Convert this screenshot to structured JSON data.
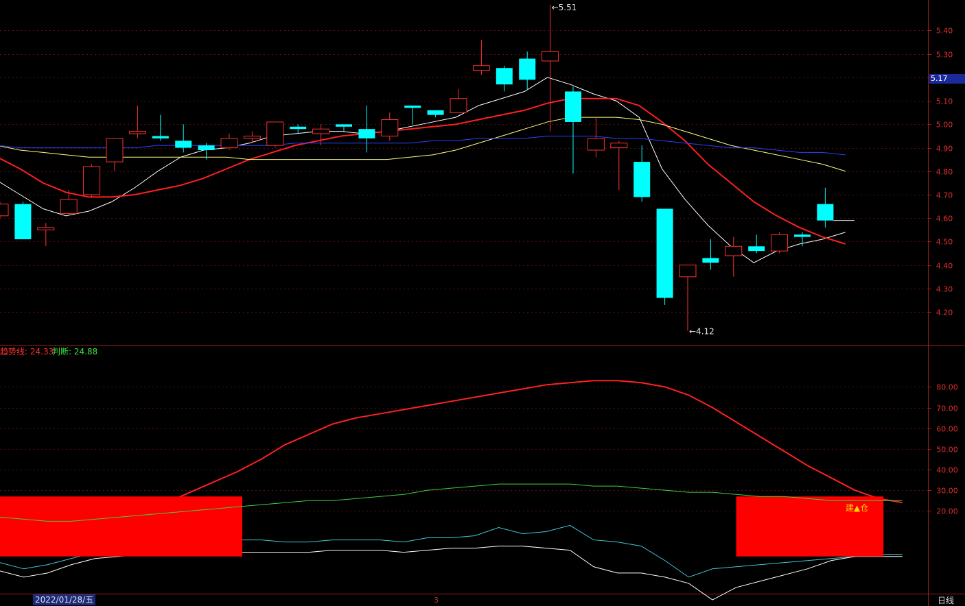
{
  "chart_data": [
    {
      "type": "candlestick",
      "y_ticks": [
        5.4,
        5.3,
        5.2,
        5.1,
        5.0,
        4.9,
        4.8,
        4.7,
        4.6,
        4.5,
        4.4,
        4.3,
        4.2
      ],
      "ylim": [
        4.06,
        5.53
      ],
      "candles": [
        {
          "open": 4.61,
          "close": 4.66,
          "high": 4.67,
          "low": 4.6
        },
        {
          "open": 4.66,
          "close": 4.51,
          "high": 4.67,
          "low": 4.51
        },
        {
          "open": 4.55,
          "close": 4.56,
          "high": 4.58,
          "low": 4.48
        },
        {
          "open": 4.62,
          "close": 4.68,
          "high": 4.72,
          "low": 4.61
        },
        {
          "open": 4.7,
          "close": 4.82,
          "high": 4.83,
          "low": 4.69
        },
        {
          "open": 4.84,
          "close": 4.94,
          "high": 4.94,
          "low": 4.8
        },
        {
          "open": 4.96,
          "close": 4.97,
          "high": 5.08,
          "low": 4.94
        },
        {
          "open": 4.95,
          "close": 4.94,
          "high": 5.04,
          "low": 4.93
        },
        {
          "open": 4.93,
          "close": 4.9,
          "high": 5.0,
          "low": 4.88
        },
        {
          "open": 4.91,
          "close": 4.89,
          "high": 4.92,
          "low": 4.85
        },
        {
          "open": 4.9,
          "close": 4.94,
          "high": 4.96,
          "low": 4.89
        },
        {
          "open": 4.94,
          "close": 4.95,
          "high": 4.97,
          "low": 4.92
        },
        {
          "open": 4.91,
          "close": 5.01,
          "high": 5.01,
          "low": 4.9
        },
        {
          "open": 4.99,
          "close": 4.98,
          "high": 5.0,
          "low": 4.96
        },
        {
          "open": 4.96,
          "close": 4.98,
          "high": 5.0,
          "low": 4.91
        },
        {
          "open": 5.0,
          "close": 4.99,
          "high": 5.0,
          "low": 4.97
        },
        {
          "open": 4.98,
          "close": 4.94,
          "high": 5.08,
          "low": 4.88
        },
        {
          "open": 4.95,
          "close": 5.02,
          "high": 5.05,
          "low": 4.93
        },
        {
          "open": 5.08,
          "close": 5.07,
          "high": 5.08,
          "low": 5.0
        },
        {
          "open": 5.06,
          "close": 5.04,
          "high": 5.06,
          "low": 5.03
        },
        {
          "open": 5.05,
          "close": 5.11,
          "high": 5.15,
          "low": 5.05
        },
        {
          "open": 5.23,
          "close": 5.25,
          "high": 5.36,
          "low": 5.21
        },
        {
          "open": 5.24,
          "close": 5.17,
          "high": 5.25,
          "low": 5.14
        },
        {
          "open": 5.28,
          "close": 5.19,
          "high": 5.31,
          "low": 5.15
        },
        {
          "open": 5.27,
          "close": 5.31,
          "high": 5.51,
          "low": 4.97
        },
        {
          "open": 5.14,
          "close": 5.01,
          "high": 5.16,
          "low": 4.79
        },
        {
          "open": 4.89,
          "close": 4.94,
          "high": 5.03,
          "low": 4.86
        },
        {
          "open": 4.9,
          "close": 4.92,
          "high": 4.93,
          "low": 4.72
        },
        {
          "open": 4.84,
          "close": 4.69,
          "high": 4.91,
          "low": 4.67
        },
        {
          "open": 4.64,
          "close": 4.26,
          "high": 4.64,
          "low": 4.23
        },
        {
          "open": 4.35,
          "close": 4.4,
          "high": 4.4,
          "low": 4.12
        },
        {
          "open": 4.43,
          "close": 4.41,
          "high": 4.51,
          "low": 4.38
        },
        {
          "open": 4.44,
          "close": 4.48,
          "high": 4.52,
          "low": 4.35
        },
        {
          "open": 4.48,
          "close": 4.46,
          "high": 4.53,
          "low": 4.45
        },
        {
          "open": 4.46,
          "close": 4.53,
          "high": 4.54,
          "low": 4.45
        },
        {
          "open": 4.53,
          "close": 4.52,
          "high": 4.54,
          "low": 4.48
        },
        {
          "open": 4.66,
          "close": 4.59,
          "high": 4.73,
          "low": 4.56
        }
      ],
      "ma_lines": [
        {
          "color": "#ffffff",
          "values": [
            4.76,
            4.7,
            4.64,
            4.61,
            4.63,
            4.67,
            4.73,
            4.8,
            4.86,
            4.89,
            4.9,
            4.92,
            4.95,
            4.96,
            4.97,
            4.97,
            4.96,
            4.97,
            4.99,
            5.01,
            5.03,
            5.08,
            5.11,
            5.14,
            5.2,
            5.17,
            5.13,
            5.1,
            5.03,
            4.81,
            4.68,
            4.57,
            4.48,
            4.41,
            4.46,
            4.49,
            4.51,
            4.54
          ]
        },
        {
          "color": "#ff2020",
          "values": [
            4.86,
            4.81,
            4.75,
            4.71,
            4.69,
            4.69,
            4.7,
            4.72,
            4.74,
            4.77,
            4.81,
            4.85,
            4.88,
            4.91,
            4.93,
            4.95,
            4.96,
            4.97,
            4.98,
            4.99,
            5.0,
            5.02,
            5.04,
            5.06,
            5.09,
            5.11,
            5.11,
            5.11,
            5.08,
            5.01,
            4.93,
            4.83,
            4.75,
            4.67,
            4.61,
            4.56,
            4.52,
            4.49
          ]
        },
        {
          "color": "#ffff80",
          "values": [
            4.91,
            4.89,
            4.88,
            4.87,
            4.86,
            4.86,
            4.86,
            4.86,
            4.86,
            4.86,
            4.86,
            4.85,
            4.85,
            4.85,
            4.85,
            4.85,
            4.85,
            4.85,
            4.86,
            4.87,
            4.89,
            4.92,
            4.95,
            4.98,
            5.01,
            5.03,
            5.03,
            5.03,
            5.02,
            5.0,
            4.97,
            4.94,
            4.91,
            4.89,
            4.87,
            4.85,
            4.83,
            4.8
          ]
        },
        {
          "color": "#3040ff",
          "values": [
            4.91,
            4.9,
            4.9,
            4.9,
            4.9,
            4.9,
            4.9,
            4.91,
            4.91,
            4.91,
            4.91,
            4.91,
            4.91,
            4.92,
            4.92,
            4.92,
            4.92,
            4.92,
            4.92,
            4.93,
            4.93,
            4.94,
            4.94,
            4.94,
            4.95,
            4.95,
            4.95,
            4.94,
            4.94,
            4.93,
            4.92,
            4.91,
            4.9,
            4.9,
            4.89,
            4.88,
            4.88,
            4.87
          ]
        }
      ],
      "annotations": {
        "high": "5.51",
        "low": "4.12"
      },
      "current_price": "5.17"
    },
    {
      "type": "line",
      "y_ticks": [
        80.0,
        70.0,
        60.0,
        50.0,
        40.0,
        30.0,
        20.0
      ],
      "ylim": [
        -20,
        100
      ],
      "series": [
        {
          "name": "趋势线",
          "value": "24.33",
          "color": "#ff2020",
          "values": [
            10,
            8,
            7,
            9,
            12,
            16,
            20,
            24,
            29,
            34,
            39,
            45,
            52,
            57,
            62,
            65,
            67,
            69,
            71,
            73,
            75,
            77,
            79,
            81,
            82,
            83,
            83,
            82,
            80,
            76,
            70,
            63,
            56,
            49,
            42,
            36,
            30,
            26,
            24
          ]
        },
        {
          "name": "判断",
          "value": "24.88",
          "color": "#40d040",
          "values": [
            17,
            16,
            15,
            15,
            16,
            17,
            18,
            19,
            20,
            21,
            22,
            23,
            24,
            25,
            25,
            26,
            27,
            28,
            30,
            31,
            32,
            33,
            33,
            33,
            33,
            32,
            32,
            31,
            30,
            29,
            29,
            28,
            27,
            27,
            26,
            25,
            25,
            25,
            25
          ]
        },
        {
          "name": "",
          "color": "#40c8d8",
          "values": [
            -5,
            -8,
            -6,
            -3,
            0,
            1,
            2,
            3,
            4,
            5,
            6,
            6,
            5,
            5,
            6,
            6,
            6,
            5,
            7,
            7,
            8,
            12,
            9,
            10,
            13,
            6,
            5,
            3,
            -4,
            -12,
            -8,
            -7,
            -6,
            -5,
            -4,
            -3,
            -2,
            -1,
            -1
          ]
        },
        {
          "name": "",
          "color": "#ffffff",
          "values": [
            -9,
            -12,
            -10,
            -6,
            -3,
            -2,
            -1,
            -1,
            0,
            0,
            0,
            0,
            0,
            0,
            1,
            1,
            1,
            0,
            1,
            2,
            2,
            3,
            3,
            2,
            1,
            -7,
            -10,
            -10,
            -12,
            -15,
            -23,
            -17,
            -14,
            -11,
            -8,
            -4,
            -2,
            -2,
            -2
          ]
        }
      ],
      "boxes": [
        {
          "x_start": 0,
          "x_end": 10,
          "y_low": -2,
          "y_high": 27
        },
        {
          "x_start": 31,
          "x_end": 37,
          "y_low": -2,
          "y_high": 27
        }
      ],
      "marker_text": "建▲仓"
    }
  ],
  "footer": {
    "date": "2022/01/28/五",
    "mark": "3",
    "period": "日线"
  }
}
